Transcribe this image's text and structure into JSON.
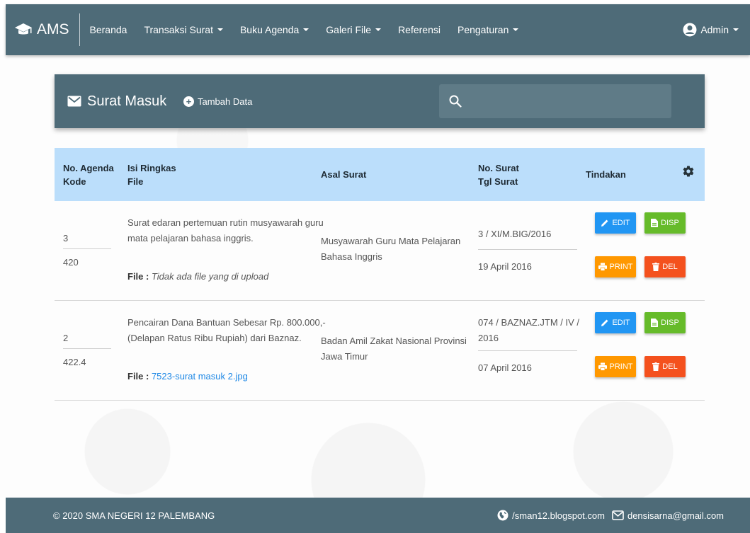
{
  "navbar": {
    "brand": "AMS",
    "items": [
      {
        "label": "Beranda",
        "dropdown": false
      },
      {
        "label": "Transaksi Surat",
        "dropdown": true
      },
      {
        "label": "Buku Agenda",
        "dropdown": true
      },
      {
        "label": "Galeri File",
        "dropdown": true
      },
      {
        "label": "Referensi",
        "dropdown": false
      },
      {
        "label": "Pengaturan",
        "dropdown": true
      }
    ],
    "user": "Admin"
  },
  "header": {
    "title": "Surat Masuk",
    "add_label": "Tambah Data",
    "search_placeholder": ""
  },
  "table": {
    "columns": {
      "agenda": "No. Agenda",
      "kode": "Kode",
      "isi": "Isi Ringkas",
      "file": "File",
      "asal": "Asal Surat",
      "no_surat": "No. Surat",
      "tgl_surat": "Tgl Surat",
      "tindakan": "Tindakan"
    },
    "rows": [
      {
        "agenda": "3",
        "kode": "420",
        "isi_line1": "Surat edaran pertemuan rutin musyawarah guru",
        "isi_line2": "mata pelajaran bahasa inggris.",
        "file_label": "File : ",
        "file_value": "Tidak ada file yang di upload",
        "file_is_link": false,
        "asal_line1": "Musyawarah Guru Mata Pelajaran",
        "asal_line2": "Bahasa Inggris",
        "no_surat_line1": "3 / XI/M.BIG/2016",
        "no_surat_line2": "",
        "tgl_surat": "19 April 2016"
      },
      {
        "agenda": "2",
        "kode": "422.4",
        "isi_line1": "Pencairan Dana Bantuan Sebesar Rp. 800.000,-",
        "isi_line2": "(Delapan Ratus Ribu Rupiah) dari Baznaz.",
        "file_label": "File : ",
        "file_value": "7523-surat masuk 2.jpg",
        "file_is_link": true,
        "asal_line1": "Badan Amil Zakat Nasional Provinsi",
        "asal_line2": "Jawa Timur",
        "no_surat_line1": "074 / BAZNAZ.JTM / IV /",
        "no_surat_line2": "2016",
        "tgl_surat": "07 April 2016"
      }
    ],
    "actions": {
      "edit": "EDIT",
      "disp": "DISP",
      "print": "PRINT",
      "del": "DEL"
    }
  },
  "footer": {
    "copyright": "© 2020 SMA NEGERI 12 PALEMBANG",
    "blog": "/sman12.blogspot.com",
    "email": "densisarna@gmail.com"
  },
  "colors": {
    "primary": "#4e6b78",
    "table_header": "#bbdefb",
    "edit": "#2196f3",
    "disp": "#66bb2a",
    "print": "#ff9800",
    "del": "#f4511e",
    "link": "#1e88e5"
  }
}
